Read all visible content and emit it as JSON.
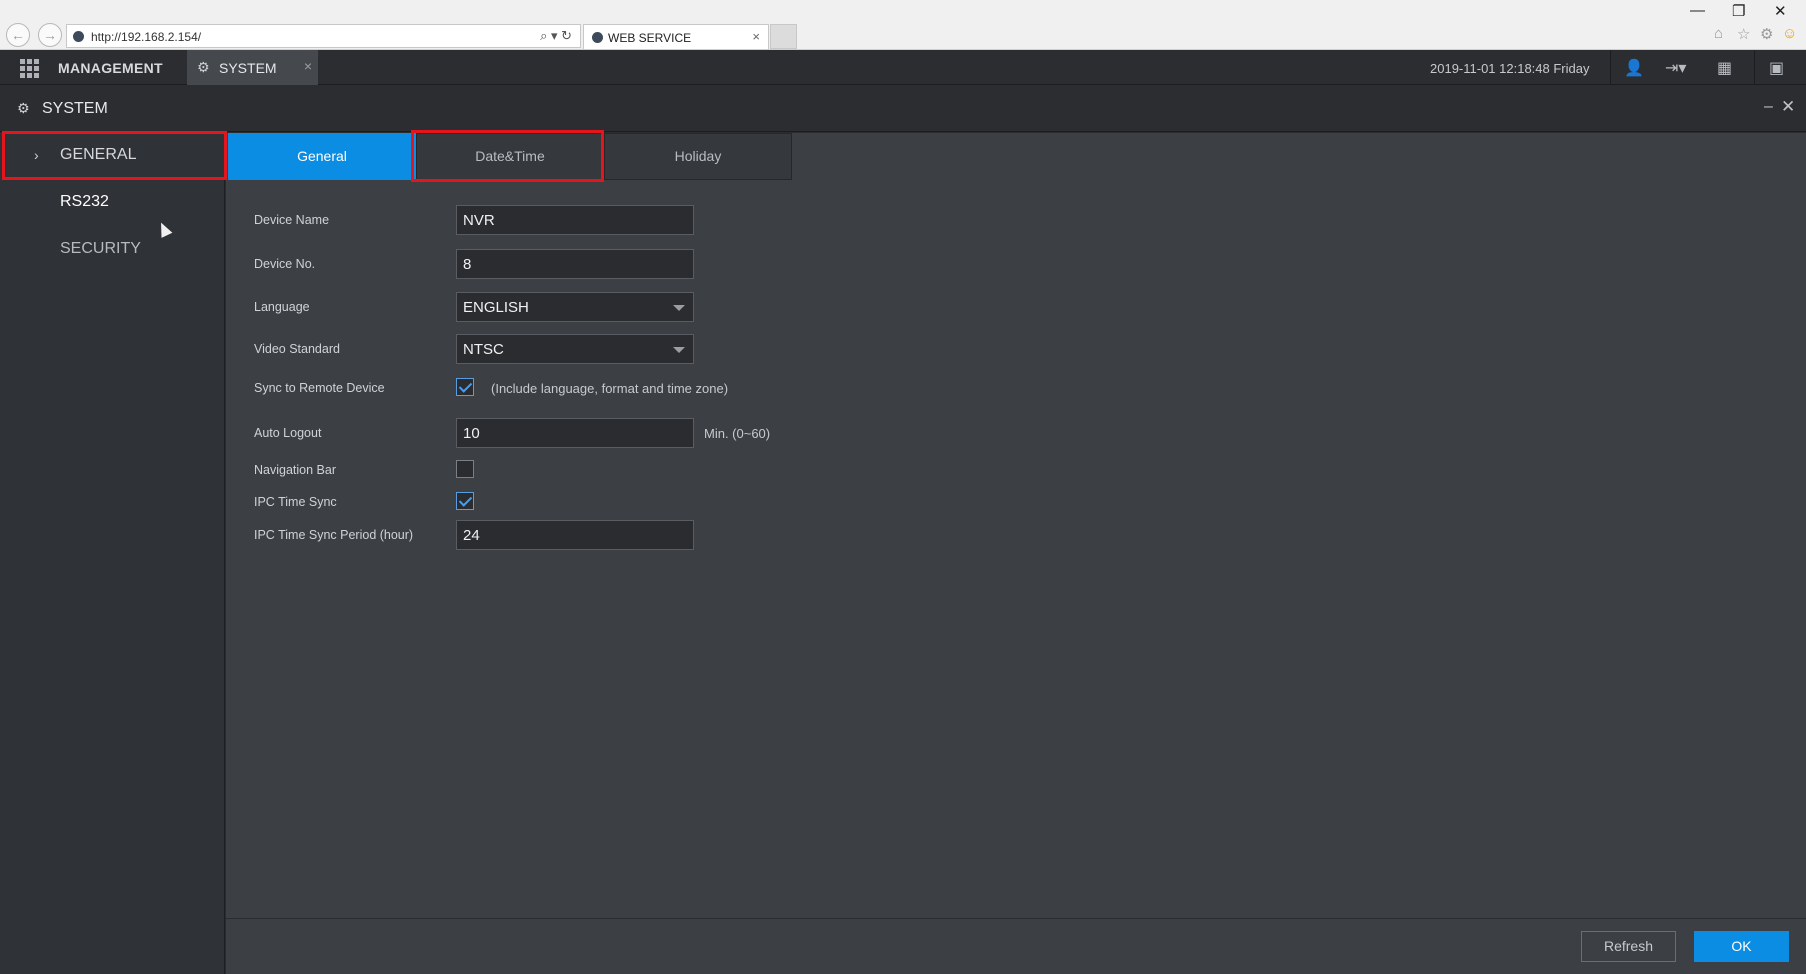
{
  "browser": {
    "url": "http://192.168.2.154/",
    "tab_title": "WEB SERVICE",
    "tab_close": "×",
    "back": "←",
    "forward": "→",
    "tools": "⌕ ▾ ↻",
    "minimize": "—",
    "restore": "❐",
    "close": "✕",
    "home": "⌂",
    "star": "☆",
    "settings": "⚙",
    "smiley": "☺"
  },
  "header": {
    "management_label": "MANAGEMENT",
    "system_tab_label": "SYSTEM",
    "system_tab_close": "×",
    "datetime": "2019-11-01 12:18:48 Friday",
    "gear": "⚙",
    "user": "👤",
    "logout": "⇥▾",
    "qr": "▦",
    "display": "▣"
  },
  "window": {
    "title": "SYSTEM",
    "gear": "⚙",
    "minimize": "–",
    "close": "✕"
  },
  "sidebar": {
    "chevron": "›",
    "items": [
      {
        "label": "GENERAL"
      },
      {
        "label": "RS232"
      },
      {
        "label": "SECURITY"
      }
    ]
  },
  "tabs": [
    {
      "label": "General"
    },
    {
      "label": "Date&Time"
    },
    {
      "label": "Holiday"
    }
  ],
  "form": {
    "device_name": {
      "label": "Device Name",
      "value": "NVR"
    },
    "device_no": {
      "label": "Device No.",
      "value": "8"
    },
    "language": {
      "label": "Language",
      "value": "ENGLISH"
    },
    "video_standard": {
      "label": "Video Standard",
      "value": "NTSC"
    },
    "sync_remote": {
      "label": "Sync to Remote Device",
      "checked": true,
      "note": "(Include language, format and time zone)"
    },
    "auto_logout": {
      "label": "Auto Logout",
      "value": "10",
      "note": "Min. (0~60)"
    },
    "navigation_bar": {
      "label": "Navigation Bar",
      "checked": false
    },
    "ipc_time_sync": {
      "label": "IPC Time Sync",
      "checked": true
    },
    "ipc_sync_period": {
      "label": "IPC Time Sync Period (hour)",
      "value": "24"
    }
  },
  "footer": {
    "refresh_label": "Refresh",
    "ok_label": "OK"
  },
  "colors": {
    "accent": "#0a8de3",
    "highlight_box": "#e5151d",
    "background": "#3c3f44"
  }
}
